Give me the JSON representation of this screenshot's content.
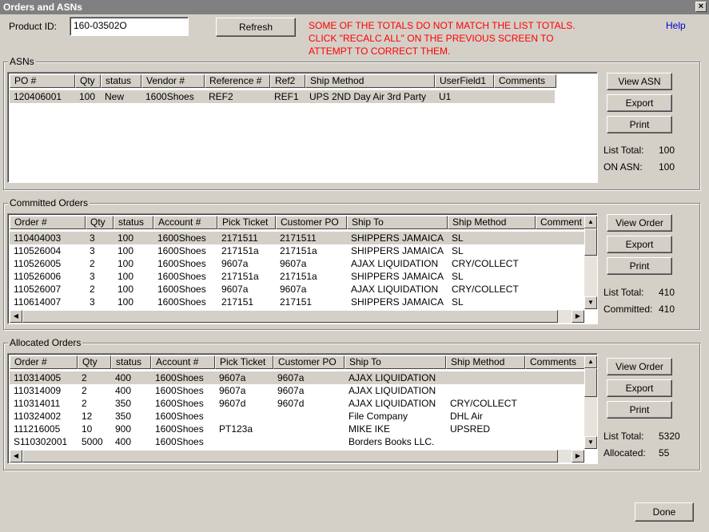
{
  "window": {
    "title": "Orders and ASNs",
    "close_glyph": "×"
  },
  "header": {
    "product_id_label": "Product ID:",
    "product_id_value": "160-03502O",
    "refresh_label": "Refresh",
    "warning_lines": [
      "SOME OF THE TOTALS DO NOT MATCH THE LIST TOTALS.",
      "CLICK \"RECALC ALL\" ON THE PREVIOUS SCREEN TO",
      "ATTEMPT TO CORRECT THEM."
    ],
    "warning_color": "#ff0000",
    "help_label": "Help"
  },
  "asns": {
    "title": "ASNs",
    "columns": [
      "PO #",
      "Qty",
      "status",
      "Vendor #",
      "Reference #",
      "Ref2",
      "Ship Method",
      "UserField1",
      "Comments"
    ],
    "rows": [
      [
        "120406001",
        "100",
        "New",
        "1600Shoes",
        "REF2",
        "REF1",
        "UPS 2ND Day Air 3rd Party",
        "U1",
        ""
      ]
    ],
    "buttons": {
      "view": "View ASN",
      "export": "Export",
      "print": "Print"
    },
    "stats": [
      {
        "label": "List Total:",
        "value": "100"
      },
      {
        "label": "ON ASN:",
        "value": "100"
      }
    ]
  },
  "committed": {
    "title": "Committed Orders",
    "columns": [
      "Order #",
      "Qty",
      "status",
      "Account #",
      "Pick Ticket",
      "Customer PO",
      "Ship To",
      "Ship Method",
      "Comment"
    ],
    "rows": [
      [
        "110404003",
        "3",
        "100",
        "1600Shoes",
        "2171511",
        "2171511",
        "SHIPPERS JAMAICA",
        "SL",
        ""
      ],
      [
        "110526004",
        "3",
        "100",
        "1600Shoes",
        "217151a",
        "217151a",
        "SHIPPERS JAMAICA",
        "SL",
        ""
      ],
      [
        "110526005",
        "2",
        "100",
        "1600Shoes",
        "9607a",
        "9607a",
        "AJAX LIQUIDATION",
        "CRY/COLLECT",
        ""
      ],
      [
        "110526006",
        "3",
        "100",
        "1600Shoes",
        "217151a",
        "217151a",
        "SHIPPERS JAMAICA",
        "SL",
        ""
      ],
      [
        "110526007",
        "2",
        "100",
        "1600Shoes",
        "9607a",
        "9607a",
        "AJAX LIQUIDATION",
        "CRY/COLLECT",
        ""
      ],
      [
        "110614007",
        "3",
        "100",
        "1600Shoes",
        "217151",
        "217151",
        "SHIPPERS JAMAICA",
        "SL",
        ""
      ]
    ],
    "buttons": {
      "view": "View Order",
      "export": "Export",
      "print": "Print"
    },
    "stats": [
      {
        "label": "List Total:",
        "value": "410"
      },
      {
        "label": "Committed:",
        "value": "410"
      }
    ]
  },
  "allocated": {
    "title": "Allocated Orders",
    "columns": [
      "Order #",
      "Qty",
      "status",
      "Account #",
      "Pick Ticket",
      "Customer PO",
      "Ship To",
      "Ship Method",
      "Comments"
    ],
    "rows": [
      [
        "110314005",
        "2",
        "400",
        "1600Shoes",
        "9607a",
        "9607a",
        "AJAX LIQUIDATION",
        "",
        ""
      ],
      [
        "110314009",
        "2",
        "400",
        "1600Shoes",
        "9607a",
        "9607a",
        "AJAX LIQUIDATION",
        "",
        ""
      ],
      [
        "110314011",
        "2",
        "350",
        "1600Shoes",
        "9607d",
        "9607d",
        "AJAX LIQUIDATION",
        "CRY/COLLECT",
        ""
      ],
      [
        "110324002",
        "12",
        "350",
        "1600Shoes",
        "",
        "",
        "File Company",
        "DHL Air",
        ""
      ],
      [
        "111216005",
        "10",
        "900",
        "1600Shoes",
        "PT123a",
        "",
        "MIKE IKE",
        "UPSRED",
        ""
      ],
      [
        "S110302001",
        "5000",
        "400",
        "1600Shoes",
        "",
        "",
        "Borders Books LLC.",
        "",
        ""
      ]
    ],
    "buttons": {
      "view": "View Order",
      "export": "Export",
      "print": "Print"
    },
    "stats": [
      {
        "label": "List Total:",
        "value": "5320"
      },
      {
        "label": "Allocated:",
        "value": "55"
      }
    ]
  },
  "footer": {
    "done_label": "Done"
  },
  "scroll_glyphs": {
    "up": "▲",
    "down": "▼",
    "left": "◀",
    "right": "▶"
  }
}
